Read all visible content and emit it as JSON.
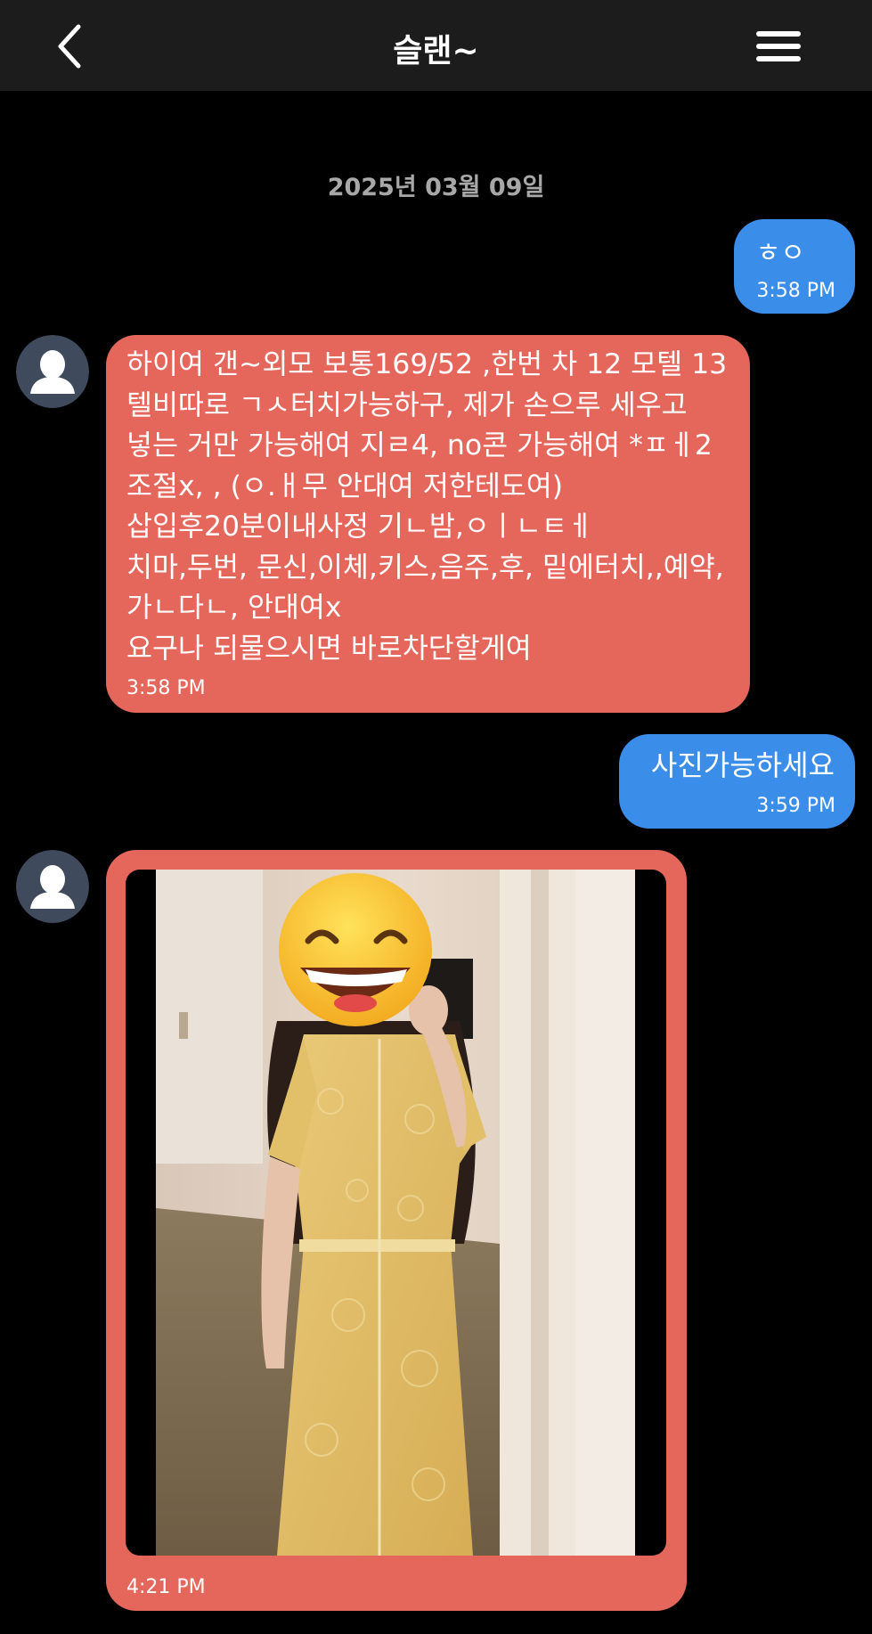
{
  "header": {
    "title": "슬랜~",
    "back_icon": "chevron-left-icon",
    "menu_icon": "hamburger-menu-icon",
    "background": "#1c1c1c"
  },
  "conversation": {
    "date": "2025년 03월 09일"
  },
  "colors": {
    "outgoing_bubble": "#3a8de8",
    "incoming_bubble": "#e5675c",
    "background": "#000000"
  },
  "messages": [
    {
      "from": "me",
      "type": "text",
      "text": "ㅎㅇ",
      "time": "3:58 PM"
    },
    {
      "from": "them",
      "type": "text",
      "text": "하이여 갠~외모 보통169/52 ,한번 차 12 모텔 13 텔비따로 ㄱㅅ터치가능하구, 제가 손으루 세우고 넣는 거만 가능해여 지ㄹ4, no콘 가능해여 *ㅍㅔ2 조절x, , (ㅇ.ㅐ무 안대여 저한테도여) 삽입후20분이내사정 기ㄴ밤,ㅇㅣㄴㅌㅔ\n치마,두번, 문신,이체,키스,음주,후, 밑에터치,,예약, 가ㄴ다ㄴ, 안대여x\n요구나 되물으시면 바로차단할게여",
      "time": "3:58 PM"
    },
    {
      "from": "me",
      "type": "text",
      "text": "사진가능하세요",
      "time": "3:59 PM"
    },
    {
      "from": "them",
      "type": "image",
      "alt": "photo of a woman in a yellow lace dress with face covered by a grinning emoji",
      "time": "4:21 PM"
    }
  ]
}
